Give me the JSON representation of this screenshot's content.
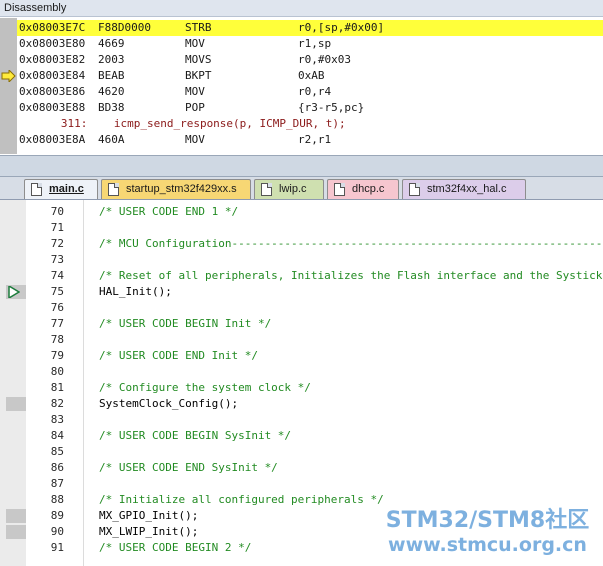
{
  "disassembly": {
    "title": "Disassembly",
    "rows": [
      {
        "addr": "0x08003E7C",
        "code": "F88D0000",
        "mnemonic": "STRB",
        "operands": "r0,[sp,#0x00]",
        "current": true
      },
      {
        "addr": "0x08003E80",
        "code": "4669",
        "mnemonic": "MOV",
        "operands": "r1,sp"
      },
      {
        "addr": "0x08003E82",
        "code": "2003",
        "mnemonic": "MOVS",
        "operands": "r0,#0x03"
      },
      {
        "addr": "0x08003E84",
        "code": "BEAB",
        "mnemonic": "BKPT",
        "operands": "0xAB",
        "pc_arrow": true
      },
      {
        "addr": "0x08003E86",
        "code": "4620",
        "mnemonic": "MOV",
        "operands": "r0,r4"
      },
      {
        "addr": "0x08003E88",
        "code": "BD38",
        "mnemonic": "POP",
        "operands": "{r3-r5,pc}"
      },
      {
        "source": "   311:    icmp_send_response(p, ICMP_DUR, t);"
      },
      {
        "addr": "0x08003E8A",
        "code": "460A",
        "mnemonic": "MOV",
        "operands": "r2,r1"
      }
    ]
  },
  "tabs": [
    {
      "label": "main.c",
      "color": "#eef2f8",
      "active": true
    },
    {
      "label": "startup_stm32f429xx.s",
      "color": "#f7d774"
    },
    {
      "label": "lwip.c",
      "color": "#cfe0b0"
    },
    {
      "label": "dhcp.c",
      "color": "#f6c6cf"
    },
    {
      "label": "stm32f4xx_hal.c",
      "color": "#dccdea"
    }
  ],
  "editor": {
    "lines": [
      {
        "no": "70",
        "text": "/* USER CODE END 1 */",
        "comment": true
      },
      {
        "no": "71",
        "text": ""
      },
      {
        "no": "72",
        "text": "/* MCU Configuration----------------------------------------------------------",
        "comment": true
      },
      {
        "no": "73",
        "text": ""
      },
      {
        "no": "74",
        "text": "/* Reset of all peripherals, Initializes the Flash interface and the Systick",
        "comment": true
      },
      {
        "no": "75",
        "text": "HAL_Init();",
        "mark": true,
        "exec": true
      },
      {
        "no": "76",
        "text": ""
      },
      {
        "no": "77",
        "text": "/* USER CODE BEGIN Init */",
        "comment": true
      },
      {
        "no": "78",
        "text": ""
      },
      {
        "no": "79",
        "text": "/* USER CODE END Init */",
        "comment": true
      },
      {
        "no": "80",
        "text": ""
      },
      {
        "no": "81",
        "text": "/* Configure the system clock */",
        "comment": true
      },
      {
        "no": "82",
        "text": "SystemClock_Config();",
        "mark": true
      },
      {
        "no": "83",
        "text": ""
      },
      {
        "no": "84",
        "text": "/* USER CODE BEGIN SysInit */",
        "comment": true
      },
      {
        "no": "85",
        "text": ""
      },
      {
        "no": "86",
        "text": "/* USER CODE END SysInit */",
        "comment": true
      },
      {
        "no": "87",
        "text": ""
      },
      {
        "no": "88",
        "text": "/* Initialize all configured peripherals */",
        "comment": true
      },
      {
        "no": "89",
        "text": "MX_GPIO_Init();",
        "mark": true
      },
      {
        "no": "90",
        "text": "MX_LWIP_Init();",
        "mark": true
      },
      {
        "no": "91",
        "text": "/* USER CODE BEGIN 2 */",
        "comment": true
      }
    ]
  },
  "watermark": {
    "line1": "STM32/STM8社区",
    "line2": "www.stmcu.org.cn"
  }
}
